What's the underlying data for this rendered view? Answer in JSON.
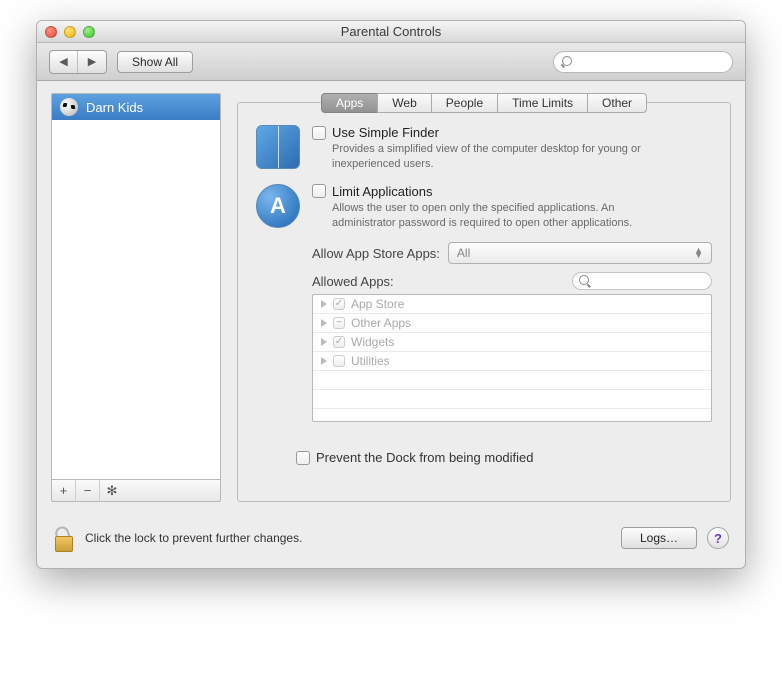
{
  "window": {
    "title": "Parental Controls"
  },
  "toolbar": {
    "show_all": "Show All",
    "search_placeholder": ""
  },
  "sidebar": {
    "users": [
      {
        "name": "Darn Kids"
      }
    ],
    "actions": {
      "add": "+",
      "remove": "−",
      "settings": "✻"
    }
  },
  "tabs": [
    "Apps",
    "Web",
    "People",
    "Time Limits",
    "Other"
  ],
  "active_tab": "Apps",
  "apps_panel": {
    "simple_finder": {
      "checked": false,
      "title": "Use Simple Finder",
      "desc": "Provides a simplified view of the computer desktop for young or inexperienced users."
    },
    "limit_apps": {
      "checked": false,
      "title": "Limit Applications",
      "desc": "Allows the user to open only the specified applications. An administrator password is required to open other applications."
    },
    "allow_store_label": "Allow App Store Apps:",
    "allow_store_value": "All",
    "allowed_apps_label": "Allowed Apps:",
    "allowed_search_placeholder": "",
    "allowed_list": [
      {
        "name": "App Store",
        "state": "checked"
      },
      {
        "name": "Other Apps",
        "state": "dash"
      },
      {
        "name": "Widgets",
        "state": "checked"
      },
      {
        "name": "Utilities",
        "state": "unchecked"
      }
    ],
    "prevent_dock": {
      "checked": false,
      "label": "Prevent the Dock from being modified"
    }
  },
  "footer": {
    "lock_text": "Click the lock to prevent further changes.",
    "logs": "Logs…",
    "help": "?"
  }
}
